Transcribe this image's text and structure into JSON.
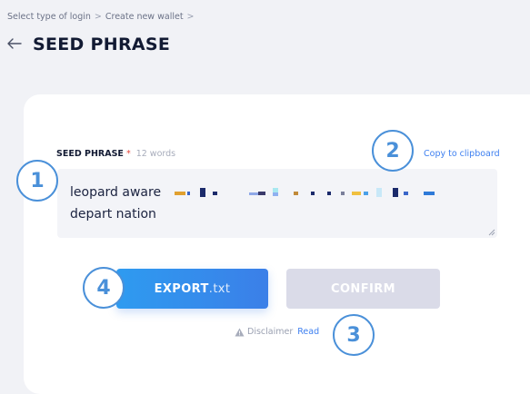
{
  "breadcrumb": {
    "items": [
      "Select type of login",
      "Create new wallet"
    ],
    "separator": ">"
  },
  "header": {
    "back_icon": "arrow-left-icon",
    "title": "SEED PHRASE"
  },
  "seed": {
    "label": "SEED PHRASE",
    "required_mark": "*",
    "word_count": "12 words",
    "copy_label": "Copy to clipboard",
    "visible_words": [
      "leopard aware",
      "depart nation"
    ]
  },
  "actions": {
    "export_label": "EXPORT",
    "export_ext": ".txt",
    "confirm_label": "CONFIRM"
  },
  "disclaimer": {
    "icon": "warning-icon",
    "label": "Disclaimer",
    "link": "Read"
  },
  "annotations": [
    "1",
    "2",
    "3",
    "4"
  ],
  "colors": {
    "accent": "#3d7ff0",
    "badge": "#4a90d9",
    "confirm_disabled": "#dadbe8",
    "required": "#e5453a"
  }
}
